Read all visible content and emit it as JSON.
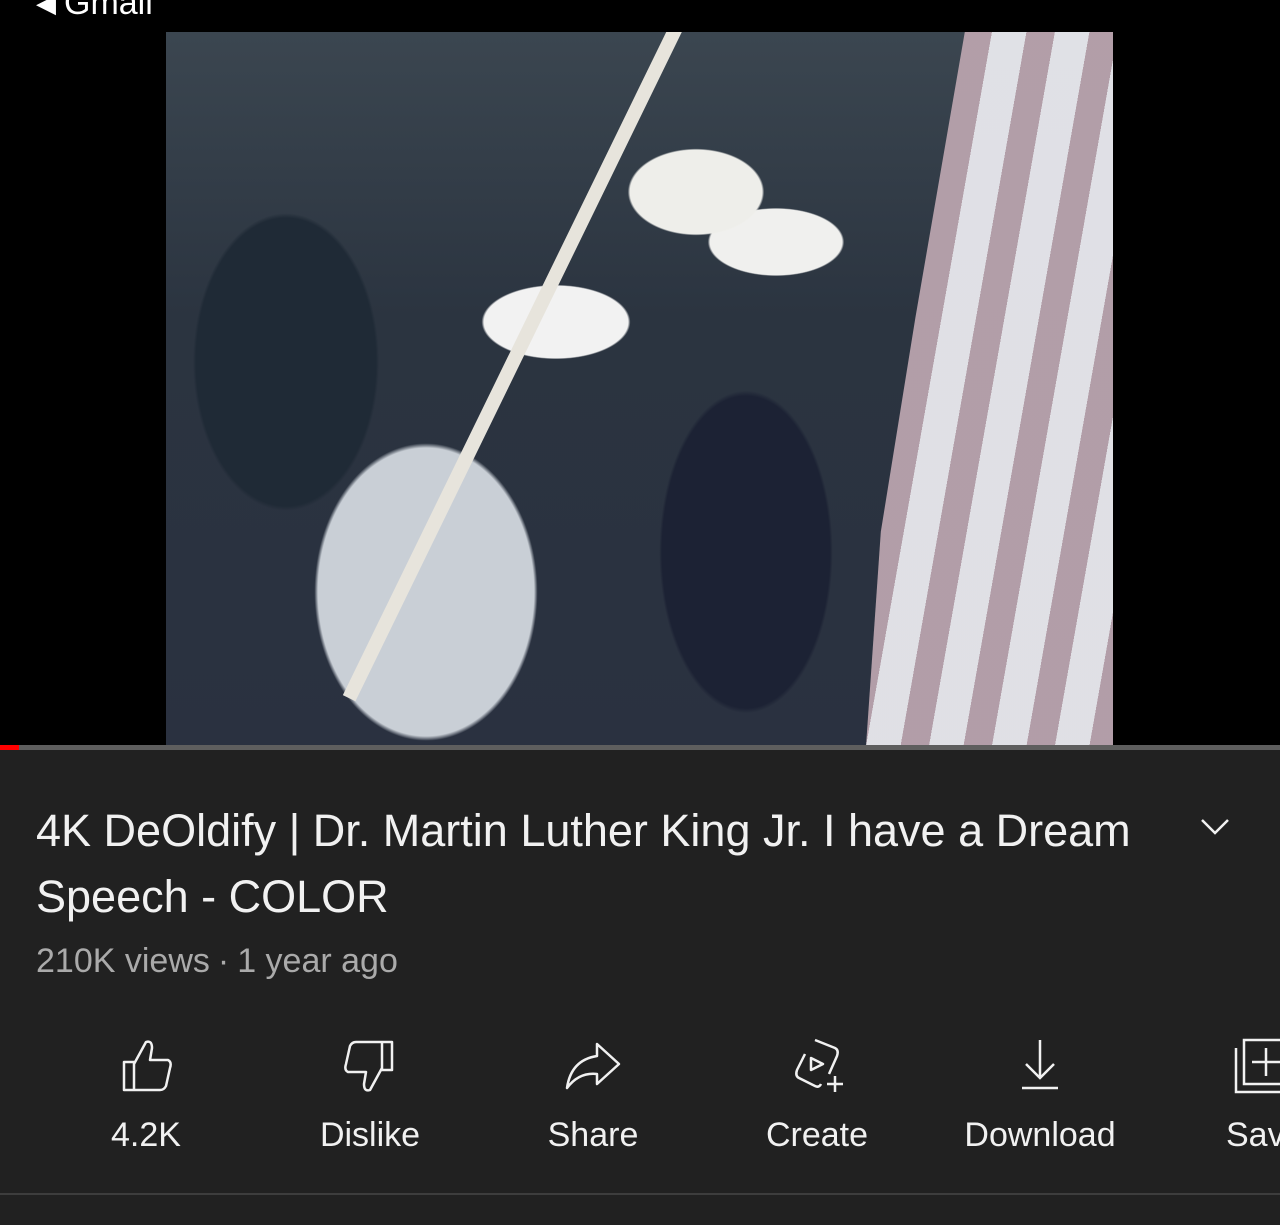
{
  "header": {
    "back_label": "Gmail",
    "back_icon": "back-triangle-icon"
  },
  "player": {
    "progress_fraction": 0.015,
    "progress_color": "#ff0000"
  },
  "video": {
    "title": "4K DeOldify | Dr. Martin Luther King Jr. I have a Dream Speech - COLOR",
    "views": "210K views",
    "separator": "·",
    "age": "1 year ago"
  },
  "actions": [
    {
      "label": "4.2K",
      "icon": "thumbs-up-icon"
    },
    {
      "label": "Dislike",
      "icon": "thumbs-down-icon"
    },
    {
      "label": "Share",
      "icon": "share-arrow-icon"
    },
    {
      "label": "Create",
      "icon": "create-sparkle-icon"
    },
    {
      "label": "Download",
      "icon": "download-icon"
    },
    {
      "label": "Save",
      "icon": "save-playlist-icon"
    }
  ]
}
